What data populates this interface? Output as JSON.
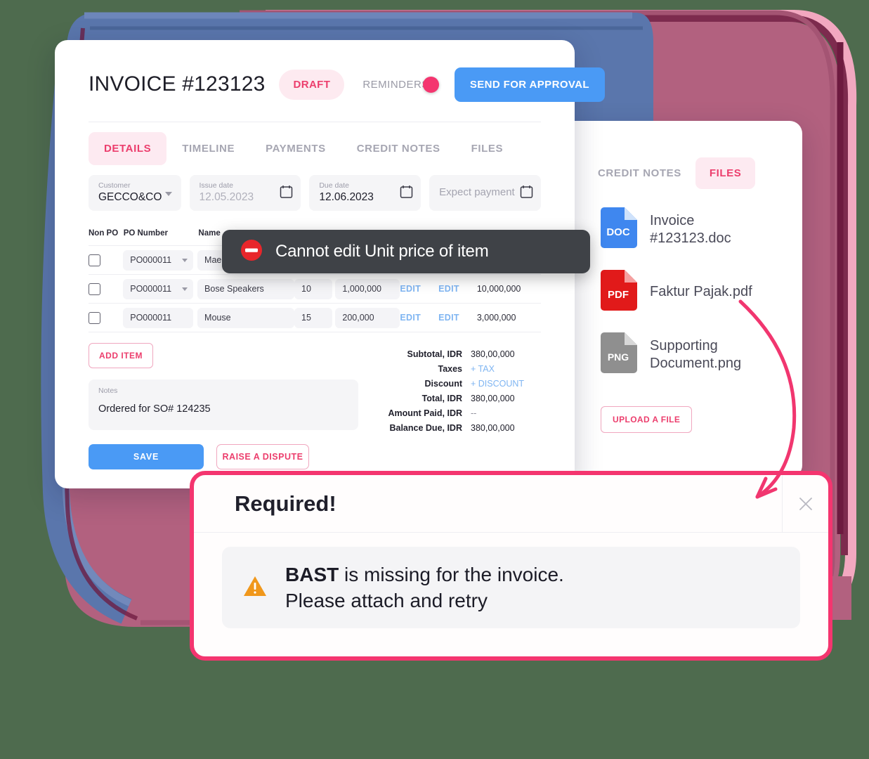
{
  "background": {
    "base_color": "#4e6b4e",
    "stroke_blue": "#5a76ac",
    "stroke_pink": "#b2617f",
    "stroke_light_pink": "#f2a8c0",
    "stroke_dark": "#6d1a3f"
  },
  "invoice": {
    "title": "INVOICE #123123",
    "status": "DRAFT",
    "reminders_label": "REMINDERS",
    "reminders_on": true,
    "send_button": "SEND FOR APPROVAL",
    "accent_pink": "#ec3e6d",
    "accent_blue": "#4a9af5",
    "tabs": [
      {
        "label": "DETAILS",
        "active": true
      },
      {
        "label": "TIMELINE",
        "active": false
      },
      {
        "label": "PAYMENTS",
        "active": false
      },
      {
        "label": "CREDIT NOTES",
        "active": false
      },
      {
        "label": "FILES",
        "active": false
      }
    ],
    "fields": {
      "customer": {
        "label": "Customer",
        "value": "GECCO&CO"
      },
      "issue_date": {
        "label": "Issue date",
        "value": "12.05.2023"
      },
      "due_date": {
        "label": "Due date",
        "value": "12.06.2023"
      },
      "expect_payment": {
        "placeholder": "Expect payment"
      }
    },
    "table": {
      "headers": {
        "non_po": "Non PO",
        "po_number": "PO Number",
        "name": "Name"
      },
      "rows": [
        {
          "po": "PO000011",
          "name": "Mae",
          "qty": "",
          "price": "",
          "edit1": "",
          "edit2": "",
          "total": ""
        },
        {
          "po": "PO000011",
          "name": "Bose Speakers",
          "qty": "10",
          "price": "1,000,000",
          "edit1": "EDIT",
          "edit2": "EDIT",
          "total": "10,000,000"
        },
        {
          "po": "PO000011",
          "name": "Mouse",
          "qty": "15",
          "price": "200,000",
          "edit1": "EDIT",
          "edit2": "EDIT",
          "total": "3,000,000"
        }
      ]
    },
    "add_item_button": "ADD ITEM",
    "totals": [
      {
        "label": "Subtotal, IDR",
        "value": "380,00,000",
        "kind": "plain"
      },
      {
        "label": "Taxes",
        "value": "+ TAX",
        "kind": "link"
      },
      {
        "label": "Discount",
        "value": "+ DISCOUNT",
        "kind": "link"
      },
      {
        "label": "Total, IDR",
        "value": "380,00,000",
        "kind": "plain"
      },
      {
        "label": "Amount Paid, IDR",
        "value": "--",
        "kind": "dash"
      },
      {
        "label": "Balance Due, IDR",
        "value": "380,00,000",
        "kind": "plain"
      }
    ],
    "notes": {
      "label": "Notes",
      "value": "Ordered for SO# 124235"
    },
    "save_button": "SAVE",
    "dispute_button": "RAISE A DISPUTE"
  },
  "files_panel": {
    "tabs": [
      {
        "label": "CREDIT NOTES",
        "active": false
      },
      {
        "label": "FILES",
        "active": true
      }
    ],
    "files": [
      {
        "type": "DOC",
        "name": "Invoice #123123.doc",
        "color": "#3f87ef"
      },
      {
        "type": "PDF",
        "name": "Faktur Pajak.pdf",
        "color": "#e11a1a"
      },
      {
        "type": "PNG",
        "name": "Supporting Document.png",
        "color": "#8f8f8f"
      }
    ],
    "upload_button": "UPLOAD A FILE"
  },
  "toast": {
    "icon": "no-entry-icon",
    "message": "Cannot edit Unit price of item",
    "background": "#3f4247",
    "icon_color": "#e8262b"
  },
  "dialog": {
    "title": "Required!",
    "close_icon": "close-icon",
    "warning_icon": "warning-triangle-icon",
    "warning_color": "#f0971b",
    "alert_bold": "BAST",
    "alert_rest": " is missing for the invoice.",
    "alert_line2": "Please attach and retry",
    "border_color": "#f4356f"
  }
}
